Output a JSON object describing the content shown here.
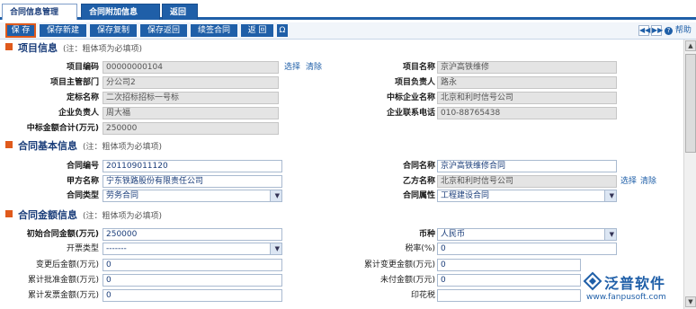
{
  "tabs": [
    "合同信息管理",
    "合同附加信息",
    "返回"
  ],
  "toolbar": {
    "buttons": [
      "保 存",
      "保存新建",
      "保存复制",
      "保存返回",
      "续签合同",
      "返 回",
      "Ω"
    ],
    "help_label": "帮助"
  },
  "sections": {
    "project": {
      "title": "项目信息",
      "note": "(注：粗体项为必填项)"
    },
    "basic": {
      "title": "合同基本信息",
      "note": "(注：粗体项为必填项)"
    },
    "amount": {
      "title": "合同金额信息",
      "note": "(注：粗体项为必填项)"
    }
  },
  "project": {
    "code_label": "项目编码",
    "code_value": "00000000104",
    "select_link": "选择",
    "clear_link": "清除",
    "name_label": "项目名称",
    "name_value": "京沪高铁维修",
    "dept_label": "项目主管部门",
    "dept_value": "分公司2",
    "manager_label": "项目负责人",
    "manager_value": "路永",
    "bid_label": "定标名称",
    "bid_value": "二次招标招标一号标",
    "winner_label": "中标企业名称",
    "winner_value": "北京和利时信号公司",
    "corp_mgr_label": "企业负责人",
    "corp_mgr_value": "周大福",
    "phone_label": "企业联系电话",
    "phone_value": "010-88765438",
    "total_label": "中标金额合计(万元)",
    "total_value": "250000"
  },
  "basic": {
    "no_label": "合同编号",
    "no_value": "201109011120",
    "name_label": "合同名称",
    "name_value": "京沪高铁维修合同",
    "party_a_label": "甲方名称",
    "party_a_value": "宁东铁路股份有限责任公司",
    "party_b_label": "乙方名称",
    "party_b_value": "北京和利时信号公司",
    "select_link": "选择",
    "clear_link": "清除",
    "type_label": "合同类型",
    "type_value": "劳务合同",
    "attr_label": "合同属性",
    "attr_value": "工程建设合同"
  },
  "amount": {
    "initial_label": "初始合同金额(万元)",
    "initial_value": "250000",
    "currency_label": "币种",
    "currency_value": "人民币",
    "invoice_type_label": "开票类型",
    "invoice_type_value": "-------",
    "tax_label": "税率(%)",
    "tax_value": "0",
    "changed_label": "变更后金额(万元)",
    "changed_value": "0",
    "cum_change_label": "累计变更金额(万元)",
    "cum_change_value": "0",
    "approved_label": "累计批准金额(万元)",
    "approved_value": "0",
    "unpaid_label": "未付金额(万元)",
    "unpaid_value": "0",
    "invoiced_label": "累计发票金额(万元)",
    "invoiced_value": "0",
    "stamp_label": "印花税"
  },
  "watermark": {
    "name": "泛普软件",
    "url": "www.fanpusoft.com"
  },
  "colors": {
    "accent": "#1f5fa8",
    "section_mark": "#e05a1c",
    "readonly_bg": "#e4e4e4"
  }
}
